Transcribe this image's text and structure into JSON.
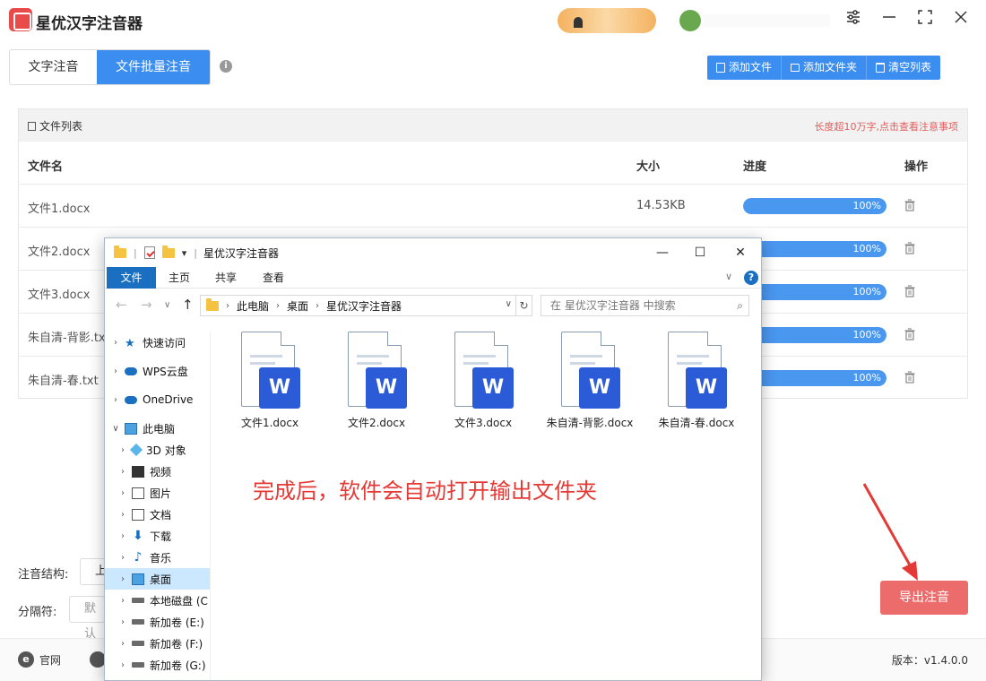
{
  "app": {
    "title": "星优汉字注音器",
    "tabs": [
      "文字注音",
      "文件批量注音"
    ],
    "toolbar": [
      "添加文件",
      "添加文件夹",
      "清空列表"
    ]
  },
  "file_list": {
    "title": "文件列表",
    "warning": "长度超10万字,点击查看注意事项",
    "headers": [
      "文件名",
      "大小",
      "进度",
      "操作"
    ],
    "rows": [
      {
        "name": "文件1.docx",
        "size": "14.53KB",
        "progress": 1.0,
        "progress_text": "100%"
      },
      {
        "name": "文件2.docx",
        "size": "",
        "progress": 1.0,
        "progress_text": "100%"
      },
      {
        "name": "文件3.docx",
        "size": "",
        "progress": 1.0,
        "progress_text": "100%"
      },
      {
        "name": "朱自清-背影.tx",
        "size": "",
        "progress": 1.0,
        "progress_text": "100%"
      },
      {
        "name": "朱自清-春.txt",
        "size": "",
        "progress": 1.0,
        "progress_text": "100%"
      }
    ]
  },
  "options": {
    "structure_label": "注音结构:",
    "structure_value": "上",
    "separator_label": "分隔符:",
    "separator_value": "默认"
  },
  "export_label": "导出注音",
  "footer": {
    "site": "官网",
    "version": "版本：v1.4.0.0"
  },
  "explorer": {
    "title": "星优汉字注音器",
    "ribbon": [
      "文件",
      "主页",
      "共享",
      "查看"
    ],
    "address": [
      "此电脑",
      "桌面",
      "星优汉字注音器"
    ],
    "search_placeholder": "在 星优汉字注音器 中搜索",
    "sidebar": [
      {
        "label": "快速访问",
        "icon": "star-icon",
        "indent": 0
      },
      {
        "label": "WPS云盘",
        "icon": "cloud-icon",
        "indent": 0
      },
      {
        "label": "OneDrive",
        "icon": "cloud-icon",
        "indent": 0
      },
      {
        "label": "此电脑",
        "icon": "computer-icon",
        "indent": 0,
        "expanded": true
      },
      {
        "label": "3D 对象",
        "icon": "cube-icon",
        "indent": 1
      },
      {
        "label": "视频",
        "icon": "film-icon",
        "indent": 1
      },
      {
        "label": "图片",
        "icon": "picture-icon",
        "indent": 1
      },
      {
        "label": "文档",
        "icon": "document-icon",
        "indent": 1
      },
      {
        "label": "下载",
        "icon": "download-icon",
        "indent": 1
      },
      {
        "label": "音乐",
        "icon": "music-icon",
        "indent": 1
      },
      {
        "label": "桌面",
        "icon": "desktop-icon",
        "indent": 1,
        "selected": true
      },
      {
        "label": "本地磁盘 (C",
        "icon": "windows-drive-icon",
        "indent": 1
      },
      {
        "label": "新加卷 (E:)",
        "icon": "drive-icon",
        "indent": 1
      },
      {
        "label": "新加卷 (F:)",
        "icon": "drive-icon",
        "indent": 1
      },
      {
        "label": "新加卷 (G:)",
        "icon": "drive-icon",
        "indent": 1
      }
    ],
    "files": [
      "文件1.docx",
      "文件2.docx",
      "文件3.docx",
      "朱自清-背影.docx",
      "朱自清-春.docx"
    ],
    "word_badge": "W"
  },
  "annotation": "完成后，软件会自动打开输出文件夹",
  "colors": {
    "accent": "#3c8df0",
    "export": "#ec6c6c",
    "annotation": "#e53935"
  }
}
